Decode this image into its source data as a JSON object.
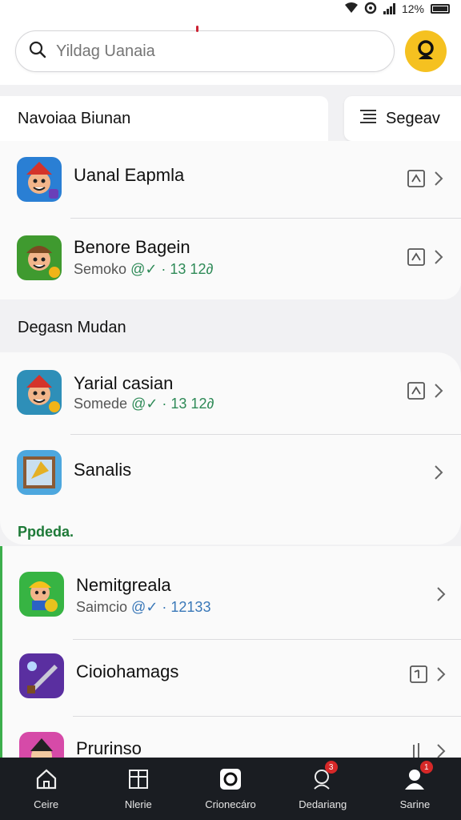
{
  "status_bar": {
    "battery": "12%"
  },
  "search": {
    "placeholder": "Yildag Uanaia"
  },
  "sections": {
    "first_header": "Navoiaa Biunan",
    "sort_label": "Segeav",
    "second_header": "Degasn Mudan",
    "third_header": "Ppdeda."
  },
  "apps": [
    {
      "title": "Uanal Eapmla",
      "subtitle": "",
      "version": ""
    },
    {
      "title": "Benore Bagein",
      "subtitle": "Semoko",
      "version": "@✓ · 13 12∂"
    },
    {
      "title": "Yarial casian",
      "subtitle": "Somede",
      "version": "@✓ · 13 12∂"
    },
    {
      "title": "Sanalis",
      "subtitle": "",
      "version": ""
    },
    {
      "title": "Nemitgreala",
      "subtitle": "Saimcio",
      "version": "@✓ · 12133"
    },
    {
      "title": "Cioiohamags",
      "subtitle": "",
      "version": ""
    },
    {
      "title": "Prurinso",
      "subtitle": "",
      "version": ""
    }
  ],
  "tabs": [
    {
      "label": "Ceire",
      "icon": "home-icon"
    },
    {
      "label": "Nlerie",
      "icon": "grid-icon"
    },
    {
      "label": "Crionecáro",
      "icon": "camera-icon"
    },
    {
      "label": "Dedariang",
      "icon": "chat-person-icon",
      "badge": "3"
    },
    {
      "label": "Sarine",
      "icon": "profile-icon",
      "badge": "1"
    }
  ],
  "colors": {
    "accent": "#f5c120",
    "tab_bg": "#1a1d22",
    "badge": "#d62828",
    "green": "#3cae4c"
  }
}
